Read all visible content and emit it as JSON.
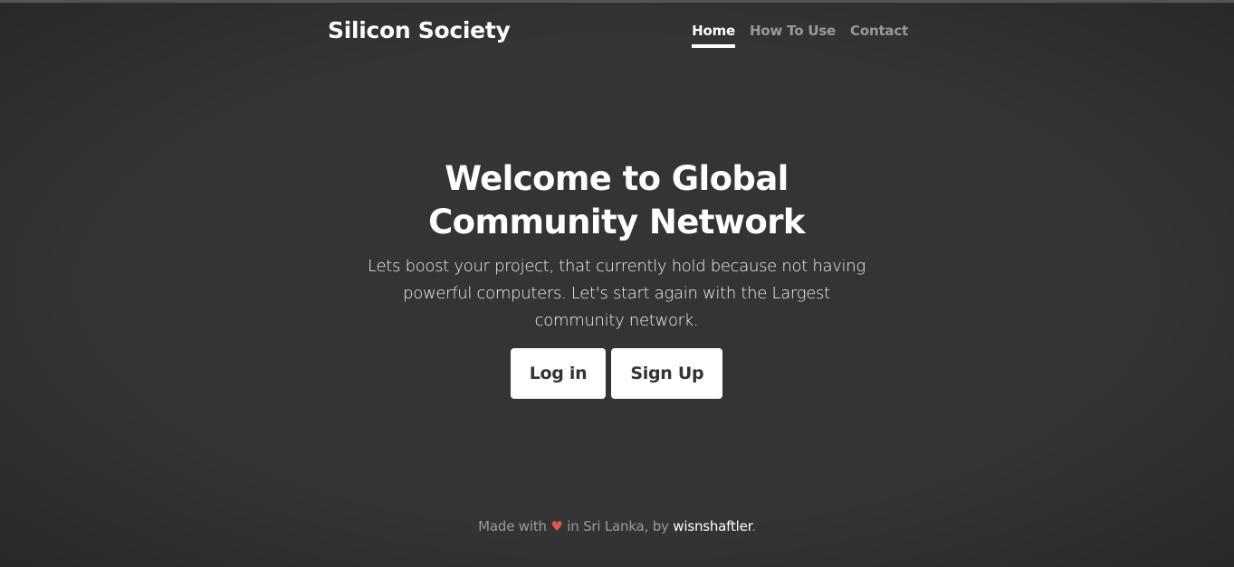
{
  "brand": {
    "name": "Silicon Society"
  },
  "nav": {
    "items": [
      {
        "label": "Home",
        "active": true
      },
      {
        "label": "How To Use",
        "active": false
      },
      {
        "label": "Contact",
        "active": false
      }
    ]
  },
  "hero": {
    "title": "Welcome to Global Community Network",
    "lead": "Lets boost your project, that currently hold because not having powerful computers. Let's start again with the Largest community network.",
    "login_label": "Log in",
    "signup_label": "Sign Up"
  },
  "footer": {
    "made_with": "Made with",
    "heart_glyph": "♥",
    "in_country": "in Sri Lanka, by",
    "author": "wisnshaftler",
    "period": "."
  },
  "colors": {
    "background": "#343434",
    "text": "#ffffff",
    "muted": "#9a9a9a",
    "heart": "#e05555",
    "button_bg": "#ffffff",
    "button_text": "#333333"
  }
}
